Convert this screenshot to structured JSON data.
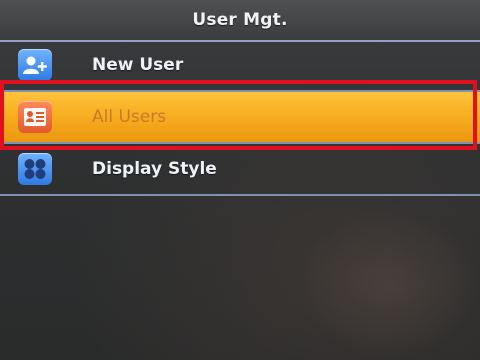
{
  "window": {
    "title": "User Mgt."
  },
  "menu": {
    "items": [
      {
        "label": "New User",
        "icon": "add-user-icon",
        "selected": false
      },
      {
        "label": "All Users",
        "icon": "user-list-icon",
        "selected": true
      },
      {
        "label": "Display Style",
        "icon": "display-style-icon",
        "selected": false
      }
    ]
  },
  "colors": {
    "selection": "#f5a81c",
    "highlight_box": "#e0101e",
    "divider": "#7e91b3",
    "icon_blue": "#2e7ae3",
    "icon_orange": "#e05a2c"
  }
}
